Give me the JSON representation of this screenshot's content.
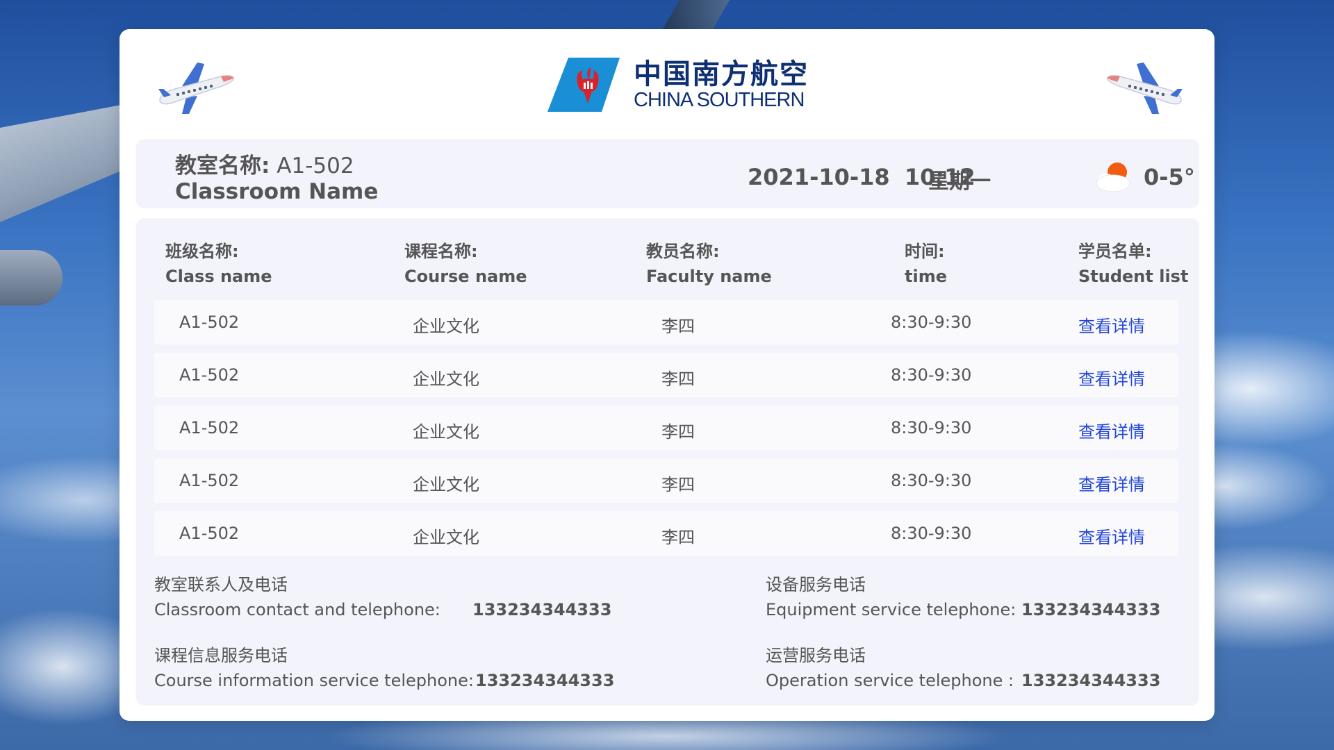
{
  "brand": {
    "cn": "中国南方航空",
    "en": "CHINA SOUTHERN"
  },
  "info": {
    "room_label_cn": "教室名称:",
    "room_value": "A1-502",
    "room_label_en": "Classroom Name",
    "date": "2021-10-18",
    "time": "10:12",
    "weekday": "星期一",
    "temperature": "0-5°",
    "weather_icon": "partly-cloudy-icon"
  },
  "table": {
    "columns": [
      {
        "cn": "班级名称:",
        "en": "Class name"
      },
      {
        "cn": "课程名称:",
        "en": "Course name"
      },
      {
        "cn": "教员名称:",
        "en": "Faculty name"
      },
      {
        "cn": "时间:",
        "en": "time"
      },
      {
        "cn": "学员名单:",
        "en": "Student list"
      }
    ],
    "rows": [
      {
        "class": "A1-502",
        "course": "企业文化",
        "faculty": "李四",
        "time": "8:30-9:30",
        "link": "查看详情"
      },
      {
        "class": "A1-502",
        "course": "企业文化",
        "faculty": "李四",
        "time": "8:30-9:30",
        "link": "查看详情"
      },
      {
        "class": "A1-502",
        "course": "企业文化",
        "faculty": "李四",
        "time": "8:30-9:30",
        "link": "查看详情"
      },
      {
        "class": "A1-502",
        "course": "企业文化",
        "faculty": "李四",
        "time": "8:30-9:30",
        "link": "查看详情"
      },
      {
        "class": "A1-502",
        "course": "企业文化",
        "faculty": "李四",
        "time": "8:30-9:30",
        "link": "查看详情"
      }
    ]
  },
  "contacts": [
    {
      "cn": "教室联系人及电话",
      "en": "Classroom contact and telephone:",
      "number": "133234344333"
    },
    {
      "cn": "设备服务电话",
      "en": "Equipment service telephone:",
      "number": "133234344333"
    },
    {
      "cn": "课程信息服务电话",
      "en": "Course information service telephone:",
      "number": "133234344333"
    },
    {
      "cn": "运营服务电话",
      "en": "Operation service telephone :",
      "number": "133234344333"
    }
  ],
  "colors": {
    "brand_navy": "#0e2f73",
    "brand_blue": "#1a8fd6",
    "brand_red": "#d8232a",
    "link_blue": "#2347d6",
    "panel_bg": "#f3f4fb",
    "sun_orange": "#f25c12"
  }
}
